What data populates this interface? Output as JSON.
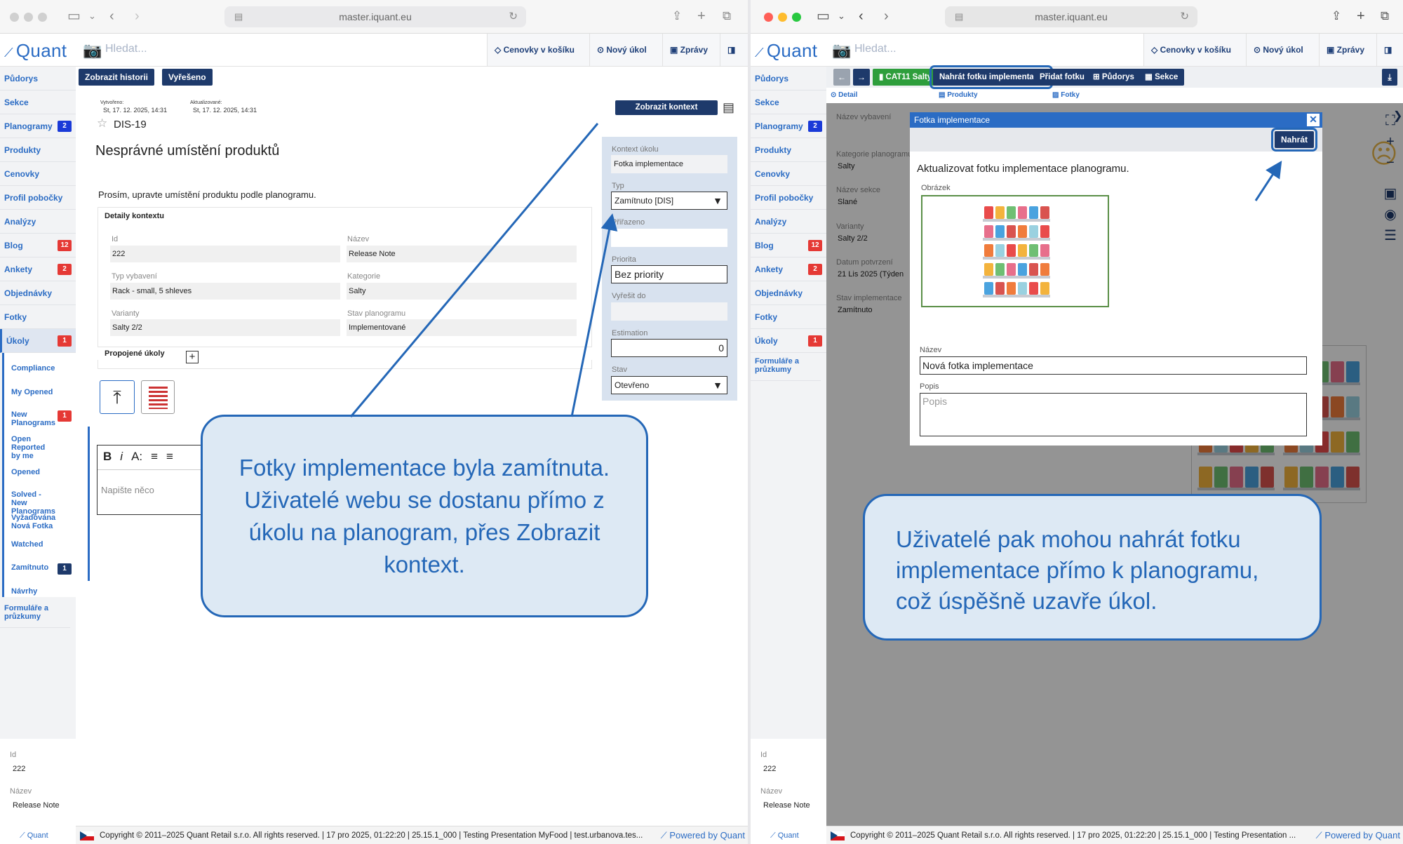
{
  "browser": {
    "url": "master.iquant.eu"
  },
  "app": {
    "logo": "Quant",
    "search_placeholder": "Hledat..."
  },
  "topbar": {
    "cenovky": "Cenovky v košíku",
    "novy_ukol": "Nový úkol",
    "zpravy": "Zprávy"
  },
  "sidebar_left": [
    {
      "label": "Půdorys"
    },
    {
      "label": "Sekce"
    },
    {
      "label": "Planogramy",
      "badge": "2",
      "badge_color": "#1a3ad8"
    },
    {
      "label": "Produkty"
    },
    {
      "label": "Cenovky"
    },
    {
      "label": "Profil pobočky"
    },
    {
      "label": "Analýzy"
    },
    {
      "label": "Blog",
      "badge": "12",
      "badge_color": "#e53935"
    },
    {
      "label": "Ankety",
      "badge": "2",
      "badge_color": "#e53935"
    },
    {
      "label": "Objednávky"
    },
    {
      "label": "Fotky"
    },
    {
      "label": "Úkoly",
      "badge": "1",
      "badge_color": "#e53935"
    }
  ],
  "ukoly_sub": [
    {
      "label": "Compliance"
    },
    {
      "label": "My Opened"
    },
    {
      "label": "New Planograms",
      "badge": "1"
    },
    {
      "label": "Open Reported by me"
    },
    {
      "label": "Opened"
    },
    {
      "label": "Solved - New Planograms"
    },
    {
      "label": "Vyžadována Nová Fotka"
    },
    {
      "label": "Watched"
    },
    {
      "label": "Zamítnuto",
      "badge": "1"
    },
    {
      "label": "Návrhy"
    }
  ],
  "sidebar_extra": "Formuláře a průzkumy",
  "sidebar_right": [
    {
      "label": "Půdorys"
    },
    {
      "label": "Sekce"
    },
    {
      "label": "Planogramy",
      "badge": "2",
      "badge_color": "#1a3ad8"
    },
    {
      "label": "Produkty"
    },
    {
      "label": "Cenovky"
    },
    {
      "label": "Profil pobočky"
    },
    {
      "label": "Analýzy"
    },
    {
      "label": "Blog",
      "badge": "12",
      "badge_color": "#e53935"
    },
    {
      "label": "Ankety",
      "badge": "2",
      "badge_color": "#e53935"
    },
    {
      "label": "Objednávky"
    },
    {
      "label": "Fotky"
    },
    {
      "label": "Úkoly",
      "badge": "1",
      "badge_color": "#e53935"
    }
  ],
  "sidebar_bottom": {
    "id_label": "Id",
    "id_value": "222",
    "nazev_label": "Název",
    "nazev_value": "Release Note",
    "footer_logo": "Quant"
  },
  "task": {
    "btn_history": "Zobrazit historii",
    "btn_solved": "Vyřešeno",
    "created_label": "Vytvořeno:",
    "created_value": "St, 17. 12. 2025, 14:31",
    "updated_label": "Aktualizované:",
    "updated_value": "St, 17. 12. 2025, 14:31",
    "code": "DIS-19",
    "title": "Nesprávné umístění produktů",
    "btn_context": "Zobrazit kontext",
    "description": "Prosím, upravte umístění produktu podle planogramu.",
    "details_title": "Detaily kontextu",
    "fields": {
      "id_label": "Id",
      "id_value": "222",
      "nazev_label": "Název",
      "nazev_value": "Release Note",
      "typ_label": "Typ vybavení",
      "typ_value": "Rack - small, 5 shleves",
      "kat_label": "Kategorie",
      "kat_value": "Salty",
      "var_label": "Varianty",
      "var_value": "Salty 2/2",
      "stav_label": "Stav planogramu",
      "stav_value": "Implementované"
    },
    "linked_title": "Propojené úkoly",
    "editor_placeholder": "Napište něco",
    "editor_tools": [
      "B",
      "i",
      "A:",
      "≡",
      "≡"
    ]
  },
  "task_panel": {
    "kontext_label": "Kontext úkolu",
    "kontext_value": "Fotka implementace",
    "typ_label": "Typ",
    "typ_value": "Zamítnuto [DIS]",
    "prirazeno_label": "Přiřazeno",
    "priorita_label": "Priorita",
    "priorita_value": "Bez priority",
    "vyresit_label": "Vyřešit do",
    "estimation_label": "Estimation",
    "estimation_value": "0",
    "stav_label": "Stav",
    "stav_value": "Otevřeno"
  },
  "right_toolbar": {
    "cat": "CAT11 Salty",
    "nahrat": "Nahrát fotku implementace",
    "pridat": "Přidat fotku",
    "pudorys": "Půdorys",
    "sekce": "Sekce"
  },
  "right_tabs": {
    "detail": "Detail",
    "produkty": "Produkty",
    "fotky": "Fotky"
  },
  "right_info": [
    {
      "label": "Název vybavení",
      "value": ""
    },
    {
      "label": "Kategorie planogramu",
      "value": "Salty"
    },
    {
      "label": "Název sekce",
      "value": "Slané"
    },
    {
      "label": "Varianty",
      "value": "Salty 2/2"
    },
    {
      "label": "Datum potvrzení",
      "value": "21 Lis 2025 (Týden"
    },
    {
      "label": "Stav implementace",
      "value": "Zamítnuto"
    }
  ],
  "modal": {
    "title": "Fotka implementace",
    "btn": "Nahrát",
    "heading": "Aktualizovat fotku implementace planogramu.",
    "obrazek_label": "Obrázek",
    "nazev_label": "Název",
    "nazev_value": "Nová fotka implementace",
    "popis_label": "Popis",
    "popis_placeholder": "Popis"
  },
  "footer": {
    "text": "Copyright © 2011–2025 Quant Retail s.r.o. All rights reserved. | 17 pro 2025, 01:22:20 | 25.15.1_000 | Testing Presentation MyFood | test.urbanova.tes...",
    "text_right": "Copyright © 2011–2025 Quant Retail s.r.o. All rights reserved. | 17 pro 2025, 01:22:20 | 25.15.1_000 | Testing Presentation ...",
    "powered": "Powered by Quant"
  },
  "callouts": {
    "left": "Fotky implementace byla zamítnuta. Uživatelé webu se dostanu přímo z úkolu na planogram, přes Zobrazit kontext.",
    "right": "Uživatelé pak mohou nahrát fotku implementace přímo k planogramu, což úspěšně uzavře úkol."
  },
  "colors": {
    "brand": "#2b6cc4",
    "button": "#1e3a6b",
    "callout_border": "#2467b7",
    "callout_bg": "#dde9f4",
    "badge_red": "#e53935",
    "badge_blue": "#1a3ad8"
  }
}
